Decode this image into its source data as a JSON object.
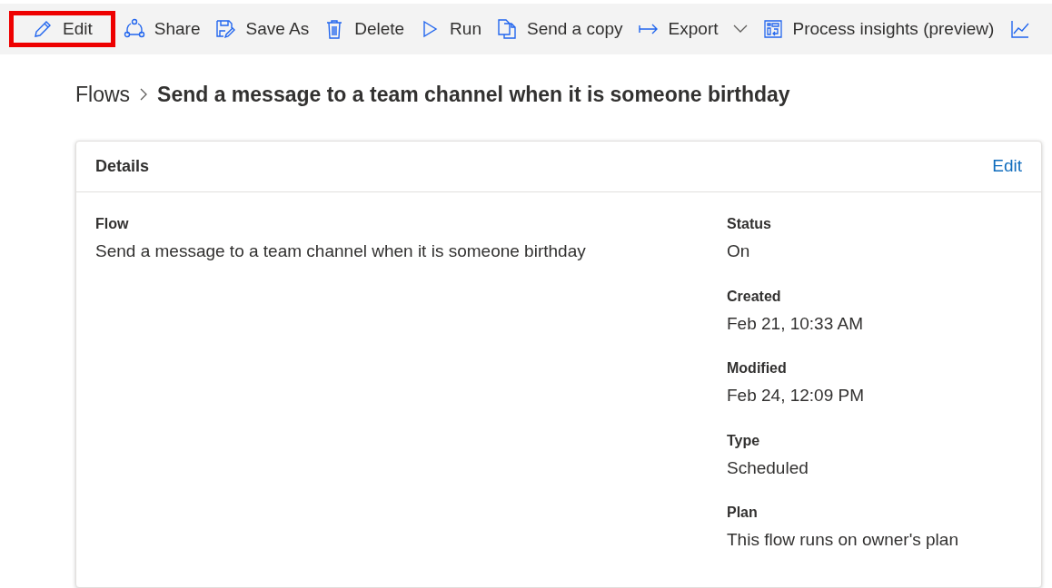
{
  "toolbar": [
    {
      "label": "Edit",
      "highlighted": true,
      "has_menu": false
    },
    {
      "label": "Share",
      "highlighted": false,
      "has_menu": false
    },
    {
      "label": "Save As",
      "highlighted": false,
      "has_menu": false
    },
    {
      "label": "Delete",
      "highlighted": false,
      "has_menu": false
    },
    {
      "label": "Run",
      "highlighted": false,
      "has_menu": false
    },
    {
      "label": "Send a copy",
      "highlighted": false,
      "has_menu": false
    },
    {
      "label": "Export",
      "highlighted": false,
      "has_menu": true
    },
    {
      "label": "Process insights (preview)",
      "highlighted": false,
      "has_menu": false
    }
  ],
  "breadcrumb": {
    "parent": "Flows",
    "current": "Send a message to a team channel when it is someone birthday"
  },
  "details": {
    "title": "Details",
    "edit_link": "Edit",
    "left": [
      {
        "label": "Flow",
        "value": "Send a message to a team channel when it is someone birthday"
      }
    ],
    "right": [
      {
        "label": "Status",
        "value": "On"
      },
      {
        "label": "Created",
        "value": "Feb 21, 10:33 AM"
      },
      {
        "label": "Modified",
        "value": "Feb 24, 12:09 PM"
      },
      {
        "label": "Type",
        "value": "Scheduled"
      },
      {
        "label": "Plan",
        "value": "This flow runs on owner's plan"
      }
    ]
  }
}
